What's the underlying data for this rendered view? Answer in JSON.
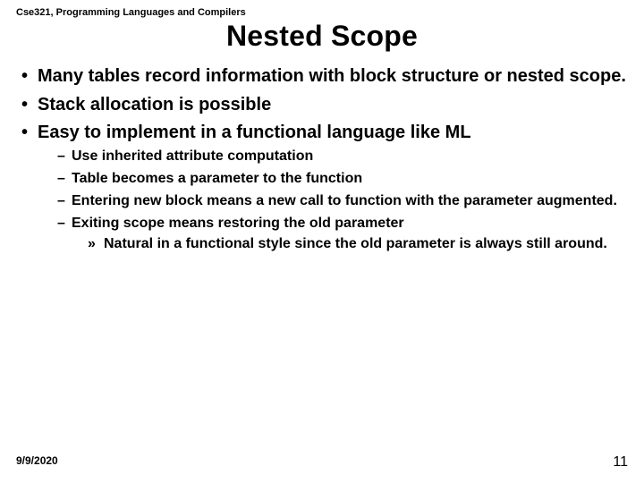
{
  "course": "Cse321, Programming Languages and Compilers",
  "title": "Nested Scope",
  "bullets": {
    "b0": "Many tables record information with block structure or nested scope.",
    "b1": "Stack allocation is possible",
    "b2": "Easy to implement in a functional language like ML",
    "s0": "Use inherited attribute computation",
    "s1": "Table becomes a parameter to the function",
    "s2": "Entering new block means a new call to function with the parameter augmented.",
    "s3": "Exiting scope means restoring the old parameter",
    "t0": "Natural in a functional style since the old parameter is always still around."
  },
  "footer": {
    "date": "9/9/2020",
    "page": "11"
  }
}
